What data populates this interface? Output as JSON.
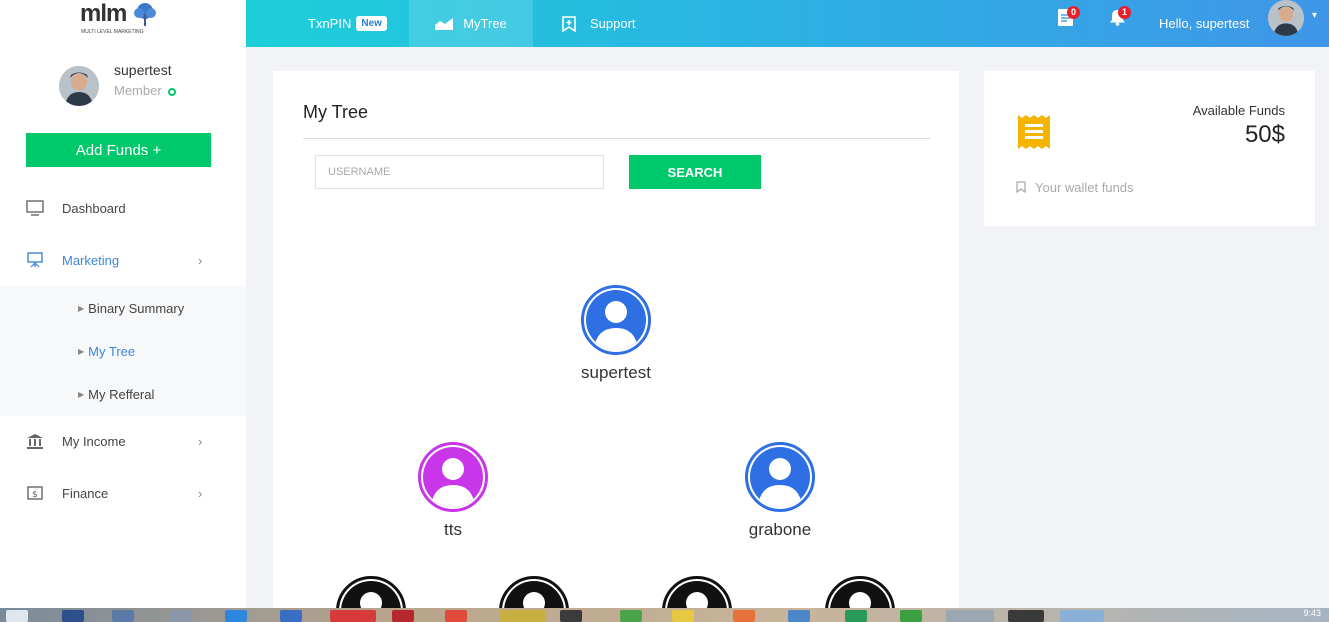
{
  "brand": {
    "name": "mlm",
    "tagline": "MULTI LEVEL MARKETING"
  },
  "profile": {
    "name": "supertest",
    "role": "Member"
  },
  "sidebar": {
    "add_funds": "Add Funds +",
    "items": [
      {
        "label": "Dashboard",
        "icon": "monitor-icon"
      },
      {
        "label": "Marketing",
        "icon": "presentation-icon"
      },
      {
        "label": "My Income",
        "icon": "bank-icon"
      },
      {
        "label": "Finance",
        "icon": "dollar-note-icon"
      }
    ],
    "submenu": [
      {
        "label": "Binary Summary"
      },
      {
        "label": "My Tree"
      },
      {
        "label": "My Refferal"
      }
    ]
  },
  "topbar": {
    "txnpin": "TxnPIN",
    "new_badge": "New",
    "mytree": "MyTree",
    "support": "Support",
    "docs_count": "0",
    "notif_count": "1",
    "greeting": "Hello, supertest"
  },
  "tree": {
    "title": "My Tree",
    "search_placeholder": "USERNAME",
    "search_button": "SEARCH",
    "nodes": [
      {
        "label": "supertest",
        "color": "#2f6fe4"
      },
      {
        "label": "tts",
        "color": "#c935e8"
      },
      {
        "label": "grabone",
        "color": "#2f6fe4"
      }
    ]
  },
  "funds": {
    "label": "Available Funds",
    "value": "50$",
    "sub": "Your wallet funds",
    "accent": "#f4b400"
  },
  "taskbar": {
    "clock": "9:43"
  }
}
